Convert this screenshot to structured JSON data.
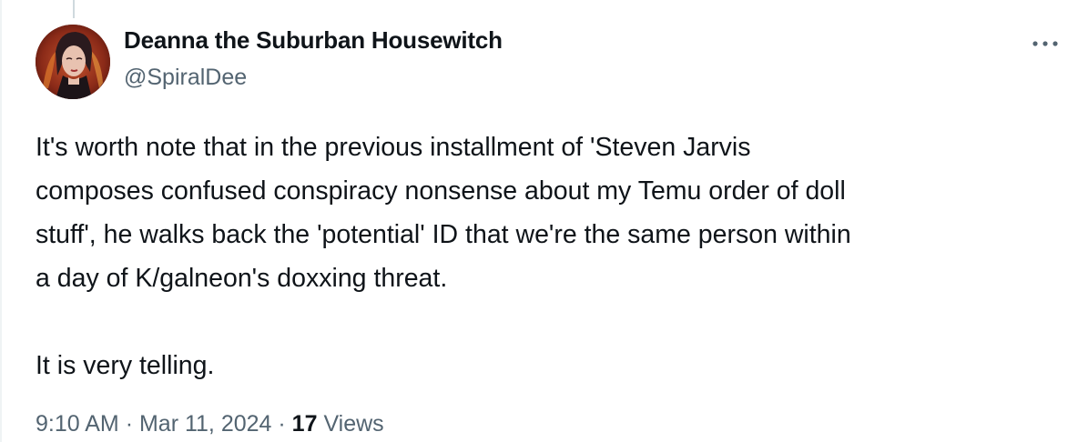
{
  "author": {
    "display_name": "Deanna the Suburban Housewitch",
    "handle": "@SpiralDee",
    "avatar_icon": "avatar-portrait-icon"
  },
  "tweet": {
    "lines": [
      "It's worth note that in the previous installment of 'Steven Jarvis",
      "composes confused conspiracy nonsense about my Temu order of doll",
      "stuff', he walks back the 'potential' ID that we're the same person within",
      "a day of K/galneon's doxxing threat.",
      "It is very telling."
    ]
  },
  "meta": {
    "time": "9:10 AM",
    "separator": "·",
    "date": "Mar 11, 2024",
    "views_count": "17",
    "views_label": "Views"
  },
  "colors": {
    "text_primary": "#0f1419",
    "text_secondary": "#536471",
    "thread_line": "#cfd9de"
  }
}
